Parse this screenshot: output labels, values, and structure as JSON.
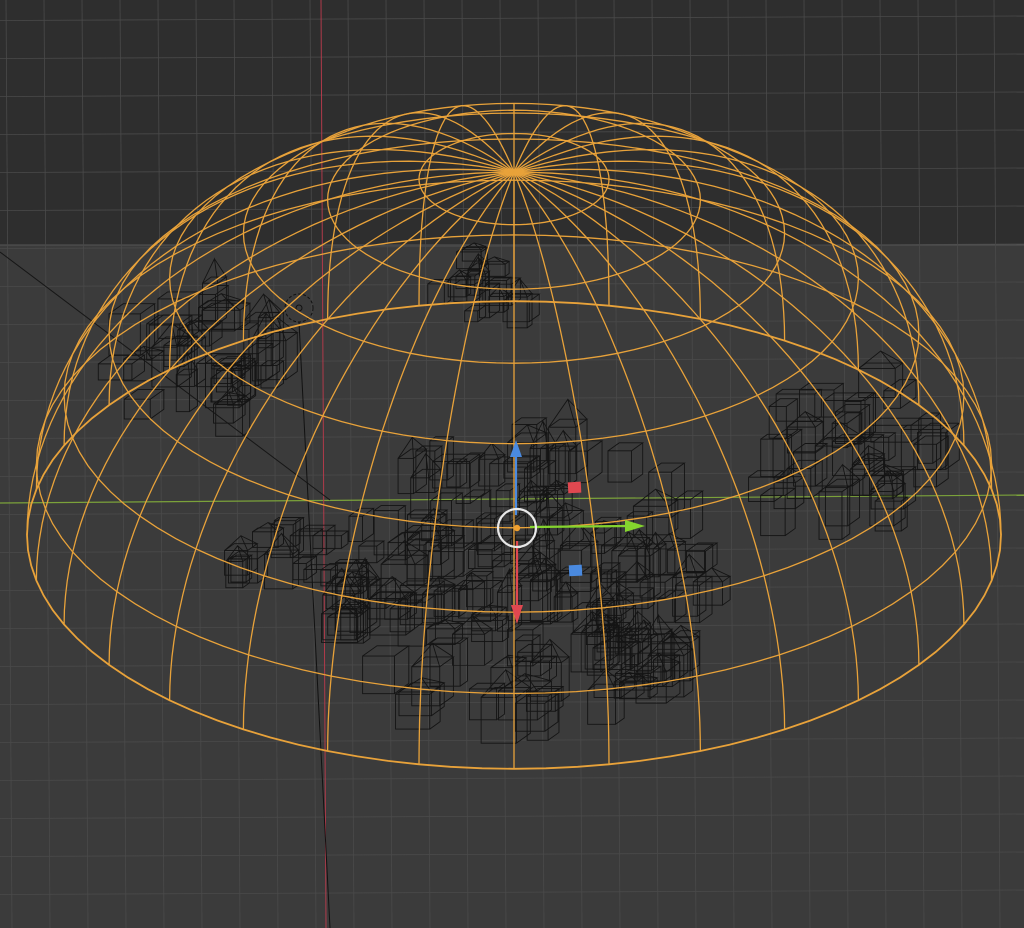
{
  "viewport": {
    "mode": "wireframe",
    "background_far": "#2e2e2e",
    "background_near": "#3b3b3b",
    "grid_color": "#4a4a4a",
    "selection_color": "#e8a23a",
    "wire_color": "#141414",
    "x_axis_color": "#7ba23a",
    "y_axis_color": "#b03a4a"
  },
  "gizmo": {
    "x_axis_color": "#84d42e",
    "y_axis_color": "#e04850",
    "z_axis_color": "#4a8ae0",
    "center_ring_color": "#e8e8e8",
    "origin_color": "#f0a030"
  },
  "objects": {
    "dome": "hemisphere-wireframe",
    "city": "building-wireframes",
    "lamp": "light-object"
  }
}
